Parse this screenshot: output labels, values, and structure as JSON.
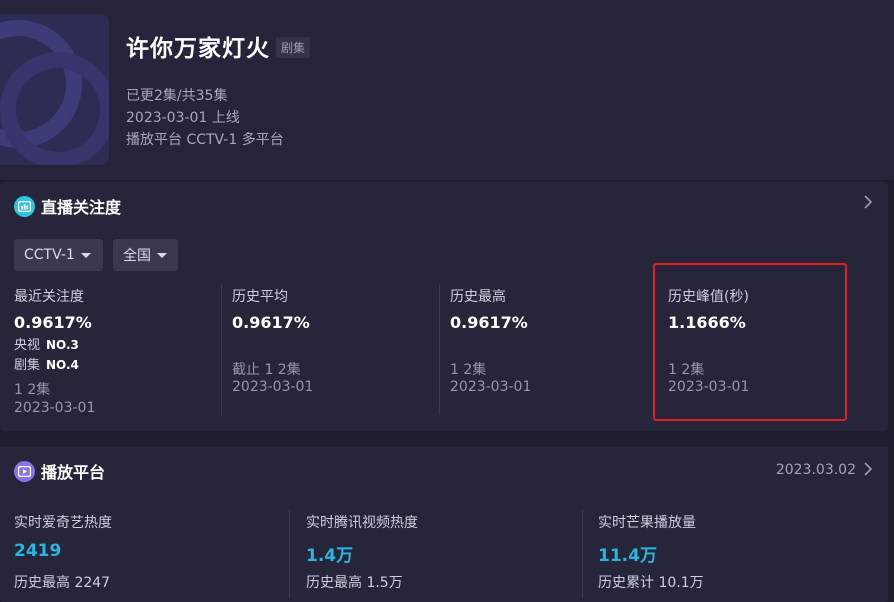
{
  "show": {
    "title": "许你万家灯火",
    "tag": "剧集",
    "update_status": "已更2集/共35集",
    "release": "2023-03-01 上线",
    "platform": "播放平台 CCTV-1 多平台"
  },
  "live": {
    "title": "直播关注度",
    "filters": {
      "channel": "CCTV-1",
      "region": "全国"
    },
    "columns": [
      {
        "label": "最近关注度",
        "value": "0.9617%",
        "rank1_label": "央视",
        "rank1_value": "NO.3",
        "rank2_label": "剧集",
        "rank2_value": "NO.4",
        "episode": "1 2集",
        "date": "2023-03-01"
      },
      {
        "label": "历史平均",
        "value": "0.9617%",
        "episode": "截止 1 2集",
        "date": "2023-03-01"
      },
      {
        "label": "历史最高",
        "value": "0.9617%",
        "episode": "1 2集",
        "date": "2023-03-01"
      },
      {
        "label": "历史峰值(秒)",
        "value": "1.1666%",
        "episode": "1 2集",
        "date": "2023-03-01"
      }
    ]
  },
  "platforms": {
    "title": "播放平台",
    "date": "2023.03.02",
    "columns": [
      {
        "label": "实时爱奇艺热度",
        "value": "2419",
        "history": "历史最高 2247"
      },
      {
        "label": "实时腾讯视频热度",
        "value": "1.4万",
        "history": "历史最高 1.5万"
      },
      {
        "label": "实时芒果播放量",
        "value": "11.4万",
        "history": "历史累计 10.1万"
      }
    ]
  },
  "icons": {
    "live_icon": "tv-chart-icon",
    "platform_icon": "play-icon",
    "chevron": "chevron-right-icon",
    "dropdown": "caret-down-icon"
  },
  "colors": {
    "accent_cyan": "#29b6e0",
    "highlight_red": "#e02020",
    "background": "#1f1e2e",
    "card": "#26253a"
  }
}
